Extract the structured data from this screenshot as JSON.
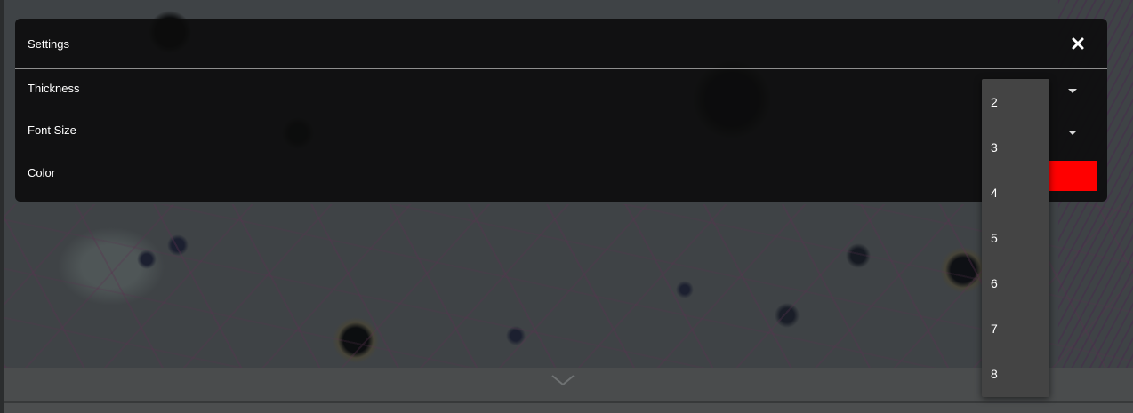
{
  "settings": {
    "title": "Settings",
    "close_icon": "close-icon",
    "rows": {
      "thickness": {
        "label": "Thickness"
      },
      "font_size": {
        "label": "Font Size"
      },
      "color": {
        "label": "Color",
        "value": "#ff0000"
      }
    }
  },
  "dropdown": {
    "options": [
      "2",
      "3",
      "4",
      "5",
      "6",
      "7",
      "8"
    ]
  },
  "bottom_bar": {
    "expand_icon": "chevron-down-icon"
  },
  "colors": {
    "panel_background": "#0c0c0c",
    "dropdown_background": "#444444",
    "accent_red": "#ff0000",
    "bottom_bar": "#4a4c4d"
  }
}
